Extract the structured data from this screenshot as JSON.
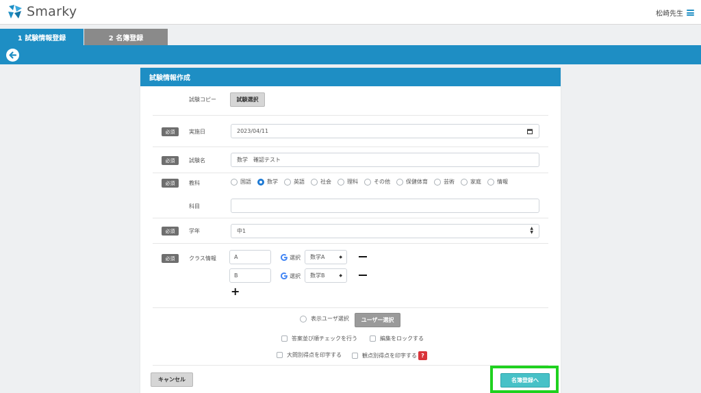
{
  "app": {
    "name": "Smarky",
    "user": "松崎先生"
  },
  "tabs": [
    {
      "label": "1 試験情報登録"
    },
    {
      "label": "2 名簿登録"
    }
  ],
  "panel": {
    "title": "試験情報作成"
  },
  "form": {
    "required_badge": "必須",
    "copy": {
      "label": "試験コピー",
      "button": "試験選択"
    },
    "date": {
      "label": "実施日",
      "value": "2023/04/11"
    },
    "name": {
      "label": "試験名",
      "value": "数学　確認テスト"
    },
    "subject": {
      "label": "教科",
      "options": [
        "国語",
        "数学",
        "英語",
        "社会",
        "理科",
        "その他",
        "保健体育",
        "芸術",
        "家庭",
        "情報"
      ],
      "selected": "数学"
    },
    "course": {
      "label": "科目",
      "value": ""
    },
    "grade": {
      "label": "学年",
      "value": "中1"
    },
    "classes": {
      "label": "クラス情報",
      "select_label": "選択",
      "rows": [
        {
          "class": "A",
          "group": "数学A"
        },
        {
          "class": "B",
          "group": "数学B"
        }
      ]
    },
    "display_user": {
      "label": "表示ユーザ選択",
      "button": "ユーザー選択"
    },
    "options": {
      "answer_order": "答案並び順チェックを行う",
      "lock_edit": "編集をロックする",
      "print_question_score": "大問別得点を印字する",
      "print_viewpoint_score": "観点別得点を印字する",
      "help": "?"
    }
  },
  "footer": {
    "cancel": "キャンセル",
    "next": "名簿登録へ"
  },
  "colors": {
    "primary": "#1e8ec4",
    "next_button": "#47c1c7",
    "highlight": "#1fd11f",
    "help": "#d9343a"
  }
}
